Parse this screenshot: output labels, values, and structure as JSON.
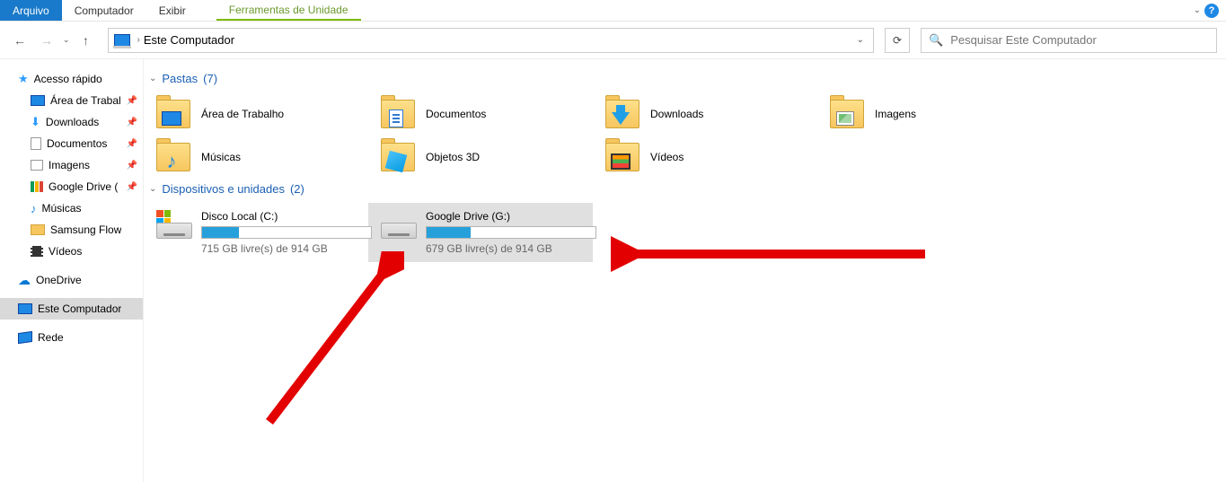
{
  "menu": {
    "arquivo": "Arquivo",
    "computador": "Computador",
    "exibir": "Exibir",
    "ferramentas": "Ferramentas de Unidade"
  },
  "address": {
    "location": "Este Computador"
  },
  "search": {
    "placeholder": "Pesquisar Este Computador"
  },
  "sidebar": {
    "quick": "Acesso rápido",
    "desktop": "Área de Trabal",
    "downloads": "Downloads",
    "documents": "Documentos",
    "images": "Imagens",
    "gdrive": "Google Drive (",
    "music": "Músicas",
    "samsung": "Samsung Flow",
    "videos": "Vídeos",
    "onedrive": "OneDrive",
    "thispc": "Este Computador",
    "network": "Rede"
  },
  "groups": {
    "folders": {
      "label": "Pastas",
      "count": "(7)"
    },
    "drives": {
      "label": "Dispositivos e unidades",
      "count": "(2)"
    }
  },
  "folders": {
    "desktop": "Área de Trabalho",
    "documents": "Documentos",
    "downloads": "Downloads",
    "images": "Imagens",
    "music": "Músicas",
    "objects3d": "Objetos 3D",
    "videos": "Vídeos"
  },
  "drives": {
    "c": {
      "name": "Disco Local (C:)",
      "free": "715 GB livre(s) de 914 GB",
      "fillpct": 22
    },
    "g": {
      "name": "Google Drive (G:)",
      "free": "679 GB livre(s) de 914 GB",
      "fillpct": 26
    }
  }
}
